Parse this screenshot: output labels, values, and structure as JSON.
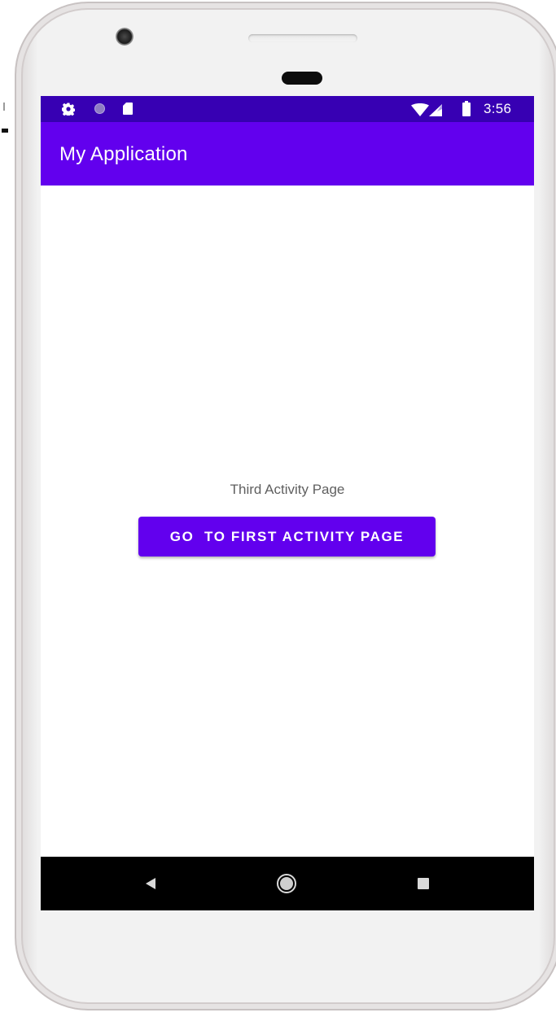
{
  "status_bar": {
    "time": "3:56",
    "left_icons": [
      "gear-icon",
      "circle-dot-icon",
      "sd-card-icon"
    ],
    "right_icons": [
      "wifi-icon",
      "cell-signal-icon",
      "battery-icon"
    ]
  },
  "app_bar": {
    "title": "My Application"
  },
  "main": {
    "label": "Third Activity Page",
    "button_label": "GO  TO FIRST ACTIVITY PAGE"
  },
  "nav_bar": {
    "buttons": [
      "back-icon",
      "home-icon",
      "recents-icon"
    ]
  },
  "colors": {
    "status_bar": "#3700b3",
    "primary": "#6200ee",
    "on_primary": "#ffffff",
    "nav_bar": "#000000"
  }
}
